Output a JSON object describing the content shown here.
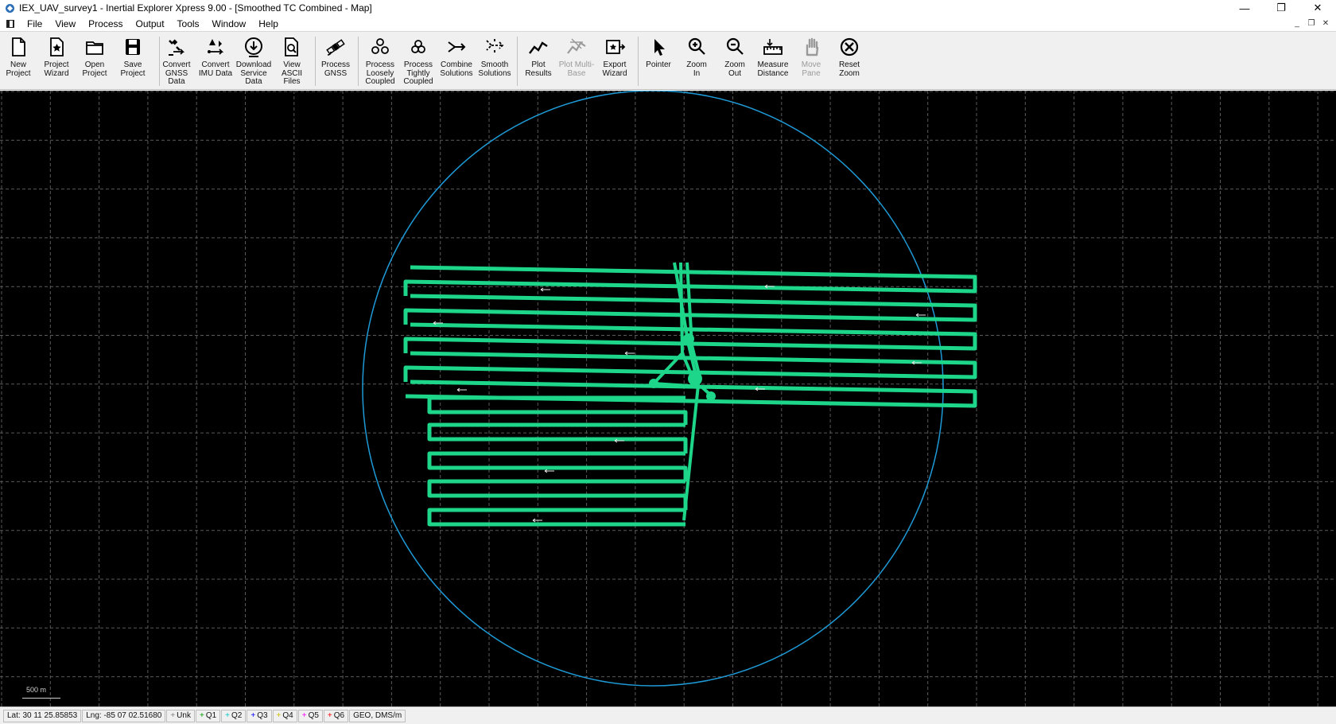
{
  "window": {
    "title": "IEX_UAV_survey1 - Inertial Explorer Xpress 9.00 - [Smoothed TC Combined - Map]",
    "controls": {
      "minimize": "—",
      "restore": "❐",
      "close": "✕"
    }
  },
  "menubar": {
    "items": [
      "File",
      "View",
      "Process",
      "Output",
      "Tools",
      "Window",
      "Help"
    ]
  },
  "toolbar": {
    "buttons": [
      {
        "label": "New\nProject",
        "icon": "new-project-icon"
      },
      {
        "label": "Project\nWizard",
        "icon": "project-wizard-icon"
      },
      {
        "label": "Open\nProject",
        "icon": "open-folder-icon"
      },
      {
        "label": "Save\nProject",
        "icon": "save-disk-icon"
      },
      {
        "label": "Convert\nGNSS\nData",
        "icon": "convert-gnss-icon"
      },
      {
        "label": "Convert\nIMU Data",
        "icon": "convert-imu-icon"
      },
      {
        "label": "Download\nService\nData",
        "icon": "download-icon"
      },
      {
        "label": "View\nASCII Files",
        "icon": "view-ascii-icon"
      },
      {
        "label": "Process\nGNSS",
        "icon": "satellite-icon"
      },
      {
        "label": "Process\nLoosely\nCoupled",
        "icon": "loosely-coupled-icon"
      },
      {
        "label": "Process\nTightly\nCoupled",
        "icon": "tightly-coupled-icon"
      },
      {
        "label": "Combine\nSolutions",
        "icon": "combine-icon"
      },
      {
        "label": "Smooth\nSolutions",
        "icon": "smooth-icon"
      },
      {
        "label": "Plot\nResults",
        "icon": "plot-line-icon"
      },
      {
        "label": "Plot Multi-\nBase",
        "icon": "plot-multibase-icon",
        "disabled": true
      },
      {
        "label": "Export\nWizard",
        "icon": "export-wizard-icon"
      },
      {
        "label": "Pointer",
        "icon": "pointer-icon"
      },
      {
        "label": "Zoom\nIn",
        "icon": "zoom-in-icon"
      },
      {
        "label": "Zoom\nOut",
        "icon": "zoom-out-icon"
      },
      {
        "label": "Measure\nDistance",
        "icon": "ruler-icon"
      },
      {
        "label": "Move\nPane",
        "icon": "hand-icon",
        "disabled": true
      },
      {
        "label": "Reset\nZoom",
        "icon": "reset-zoom-icon"
      }
    ]
  },
  "map": {
    "scale_label": "500 m",
    "colors": {
      "background": "#000000",
      "grid": "#5a5a5a",
      "trajectory": "#1dd68a",
      "circle": "#1e9ad6"
    }
  },
  "statusbar": {
    "lat": "Lat: 30 11 25.85853",
    "lng": "Lng: -85 07 02.51680",
    "quality": [
      {
        "label": "Unk",
        "color": "#808080"
      },
      {
        "label": "Q1",
        "color": "#00a000"
      },
      {
        "label": "Q2",
        "color": "#00c8c8"
      },
      {
        "label": "Q3",
        "color": "#0000ff"
      },
      {
        "label": "Q4",
        "color": "#d0c000"
      },
      {
        "label": "Q5",
        "color": "#ff00ff"
      },
      {
        "label": "Q6",
        "color": "#ff0000"
      }
    ],
    "coord_mode": "GEO, DMS/m"
  }
}
